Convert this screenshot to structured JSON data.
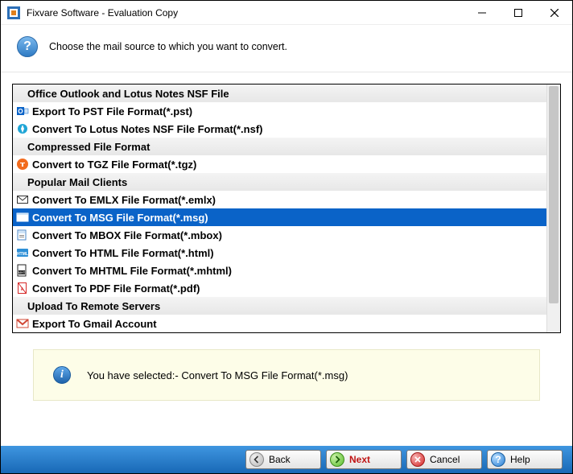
{
  "window": {
    "title": "Fixvare Software - Evaluation Copy"
  },
  "instruction": {
    "text": "Choose the mail source to which you want to convert."
  },
  "list": [
    {
      "kind": "header",
      "label": "Office Outlook and Lotus Notes NSF File"
    },
    {
      "kind": "item",
      "icon": "outlook-icon",
      "label": "Export To PST File Format(*.pst)"
    },
    {
      "kind": "item",
      "icon": "lotus-icon",
      "label": "Convert To Lotus Notes NSF File Format(*.nsf)"
    },
    {
      "kind": "header",
      "label": "Compressed File Format"
    },
    {
      "kind": "item",
      "icon": "tgz-icon",
      "label": "Convert to TGZ File Format(*.tgz)"
    },
    {
      "kind": "header",
      "label": "Popular Mail Clients"
    },
    {
      "kind": "item",
      "icon": "emlx-icon",
      "label": "Convert To EMLX File Format(*.emlx)"
    },
    {
      "kind": "item",
      "icon": "msg-icon",
      "label": "Convert To MSG File Format(*.msg)",
      "selected": true
    },
    {
      "kind": "item",
      "icon": "mbox-icon",
      "label": "Convert To MBOX File Format(*.mbox)"
    },
    {
      "kind": "item",
      "icon": "html-icon",
      "label": "Convert To HTML File Format(*.html)"
    },
    {
      "kind": "item",
      "icon": "mhtml-icon",
      "label": "Convert To MHTML File Format(*.mhtml)"
    },
    {
      "kind": "item",
      "icon": "pdf-icon",
      "label": "Convert To PDF File Format(*.pdf)"
    },
    {
      "kind": "header",
      "label": "Upload To Remote Servers"
    },
    {
      "kind": "item",
      "icon": "gmail-icon",
      "label": "Export To Gmail Account"
    }
  ],
  "status": {
    "text": "You have selected:- Convert To MSG File Format(*.msg)"
  },
  "buttons": {
    "back": "Back",
    "next": "Next",
    "cancel": "Cancel",
    "help": "Help"
  }
}
